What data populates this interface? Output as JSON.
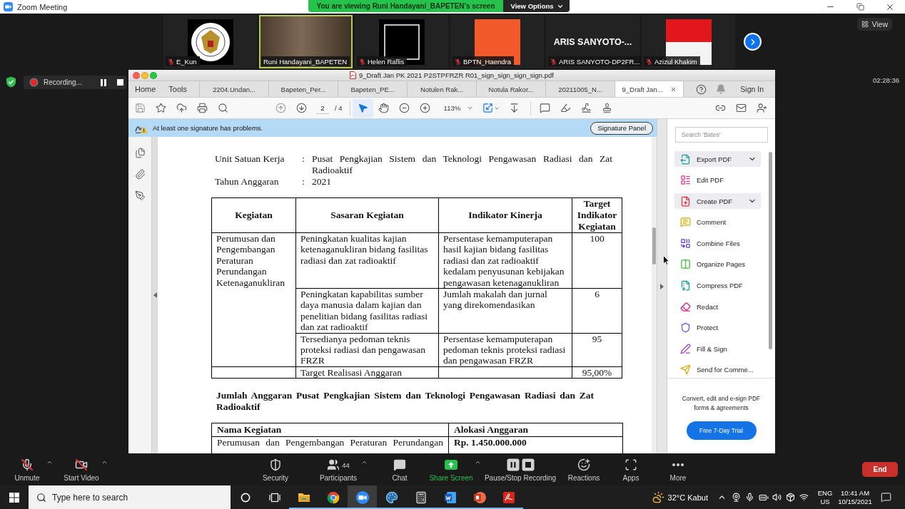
{
  "zoom_window": {
    "title": "Zoom Meeting",
    "banner": "You are viewing Runi Handayani_BAPETEN's screen",
    "view_options": "View Options"
  },
  "participants": [
    {
      "kind": "emblem",
      "name": "E_Kun",
      "muted": true,
      "speaking": false
    },
    {
      "kind": "video",
      "name": "Runi Handayani_BAPETEN",
      "muted": false,
      "speaking": true
    },
    {
      "kind": "card",
      "name": "Helen Raflis",
      "muted": true,
      "speaking": false
    },
    {
      "kind": "poster",
      "name": "BPTN_Haendra",
      "muted": true,
      "speaking": false
    },
    {
      "kind": "name",
      "display": "ARIS SANYOTO-...",
      "name": "ARIS SANYOTO-DP2FR...",
      "muted": true,
      "speaking": false
    },
    {
      "kind": "photo",
      "name": "Azizul Khakim",
      "muted": true,
      "speaking": false
    }
  ],
  "view_button": "View",
  "recording": {
    "label": "Recording..."
  },
  "timer": "02:28:36",
  "acrobat": {
    "title": "9_Draft Jan PK 2021 P2STPFRZR R01_sign_sign_sign_sign.pdf",
    "nav": [
      "Home",
      "Tools"
    ],
    "tabs": [
      {
        "label": "2204.Undan...",
        "selected": false
      },
      {
        "label": "Bapeten_Per...",
        "selected": false
      },
      {
        "label": "Bapeten_PE...",
        "selected": false
      },
      {
        "label": "Notulen Rak...",
        "selected": false
      },
      {
        "label": "Notula Rakor...",
        "selected": false
      },
      {
        "label": "20211005_N...",
        "selected": false
      },
      {
        "label": "9_Draft Jan...",
        "selected": true
      }
    ],
    "sign_in": "Sign In",
    "page": "2",
    "page_total": "/ 4",
    "view_tools": [
      {
        "kind": "select",
        "selected": true
      },
      {
        "kind": "hand",
        "selected": false
      }
    ],
    "zoom": "113%",
    "notice": {
      "text": "At least one signature has problems.",
      "button": "Signature Panel"
    }
  },
  "document": {
    "info": [
      {
        "label": "Unit Satuan Kerja",
        "separator": ":",
        "value": "Pusat Pengkajian Sistem dan Teknologi Pengawasan Radiasi dan Zat Radioaktif"
      },
      {
        "label": "Tahun Anggaran",
        "separator": ":",
        "value": "2021"
      }
    ],
    "targets_table": {
      "columns": [
        "Kegiatan",
        "Sasaran Kegiatan",
        "Indikator Kinerja",
        "Target Indikator Kegiatan"
      ],
      "groups": [
        {
          "activity": "Perumusan dan Pengembangan Peraturan Perundangan Ketenaganukliran",
          "rows": [
            {
              "goal": "Peningkatan kualitas kajian ketenaganukliran bidang fasilitas radiasi dan zat radioaktif",
              "indicator": "Persentase kemamputerapan hasil kajian bidang fasilitas radiasi dan zat radioaktif kedalam penyusunan kebijakan pengawasan ketenaganukliran",
              "target": "100"
            },
            {
              "goal": "Peningkatan kapabilitas sumber daya manusia dalam kajian dan penelitian bidang fasilitas radiasi dan zat radioaktif",
              "indicator": "Jumlah makalah dan jurnal yang direkomendasikan",
              "target": "6"
            },
            {
              "goal": "Tersedianya pedoman teknis proteksi radiasi dan pengawasan FRZR",
              "indicator": "Persentase kemamputerapan pedoman teknis proteksi radiasi dan pengawasan FRZR",
              "target": "95"
            }
          ]
        }
      ],
      "total": {
        "label": "Target Realisasi Anggaran",
        "value": "95,00%"
      }
    },
    "budget_heading": "Jumlah Anggaran Pusat Pengkajian Sistem dan Teknologi Pengawasan Radiasi dan Zat Radioaktif",
    "budget_table": {
      "columns": [
        "Nama Kegiatan",
        "Alokasi Anggaran"
      ],
      "rows": [
        {
          "activity": "Perumusan dan Pengembangan Peraturan Perundangan",
          "amount": "Rp. 1.450.000.000"
        }
      ]
    }
  },
  "tools_panel": {
    "search": {
      "placeholder": "Search 'Bates'"
    },
    "tools": [
      {
        "kind": "export",
        "label": "Export PDF",
        "expandable": true
      },
      {
        "kind": "edit",
        "label": "Edit PDF",
        "expandable": false
      },
      {
        "kind": "create",
        "label": "Create PDF",
        "expandable": true
      },
      {
        "kind": "comment",
        "label": "Comment",
        "expandable": false
      },
      {
        "kind": "combine",
        "label": "Combine Files",
        "expandable": false
      },
      {
        "kind": "organize",
        "label": "Organize Pages",
        "expandable": false
      },
      {
        "kind": "compress",
        "label": "Compress PDF",
        "expandable": false
      },
      {
        "kind": "redact",
        "label": "Redact",
        "expandable": false
      },
      {
        "kind": "protect",
        "label": "Protect",
        "expandable": false
      },
      {
        "kind": "fill_sign",
        "label": "Fill & Sign",
        "expandable": false
      },
      {
        "kind": "send",
        "label": "Send for Comme...",
        "expandable": false
      }
    ],
    "promo": "Convert, edit and e-sign PDF forms & agreements",
    "trial_button": "Free 7-Day Trial"
  },
  "meeting_controls": [
    {
      "kind": "microphone",
      "label": "Unmute",
      "off": true,
      "menu": true
    },
    {
      "kind": "video",
      "label": "Start Video",
      "off": true,
      "menu": true
    },
    {
      "kind": "security",
      "label": "Security",
      "off": false,
      "menu": false
    },
    {
      "kind": "participants",
      "label": "Participants",
      "count": "44",
      "off": false,
      "menu": true
    },
    {
      "kind": "chat",
      "label": "Chat",
      "off": false,
      "menu": false
    },
    {
      "kind": "share",
      "label": "Share Screen",
      "off": false,
      "menu": true
    },
    {
      "kind": "record",
      "label": "Pause/Stop Recording",
      "off": false,
      "menu": false
    },
    {
      "kind": "reactions",
      "label": "Reactions",
      "off": false,
      "menu": false
    },
    {
      "kind": "apps",
      "label": "Apps",
      "off": false,
      "menu": false
    },
    {
      "kind": "more",
      "label": "More",
      "off": false,
      "menu": false
    }
  ],
  "end_button": "End",
  "taskbar": {
    "search": {
      "placeholder": "Type here to search"
    },
    "apps": [
      {
        "kind": "cortana",
        "running": false,
        "selected": false
      },
      {
        "kind": "task_view",
        "running": false,
        "selected": false
      },
      {
        "kind": "explorer",
        "running": true,
        "selected": false
      },
      {
        "kind": "chrome",
        "running": true,
        "selected": false
      },
      {
        "kind": "zoom",
        "running": true,
        "selected": true
      },
      {
        "kind": "paint",
        "running": true,
        "selected": false
      },
      {
        "kind": "calculator",
        "running": true,
        "selected": false
      },
      {
        "kind": "word",
        "running": true,
        "selected": false
      },
      {
        "kind": "powerpoint",
        "running": true,
        "selected": false
      },
      {
        "kind": "acrobat",
        "running": true,
        "selected": false
      }
    ],
    "weather": "32°C Kabut",
    "language": {
      "input": "ENG",
      "region": "US"
    },
    "clock": {
      "time": "10:41 AM",
      "date": "10/15/2021"
    }
  }
}
